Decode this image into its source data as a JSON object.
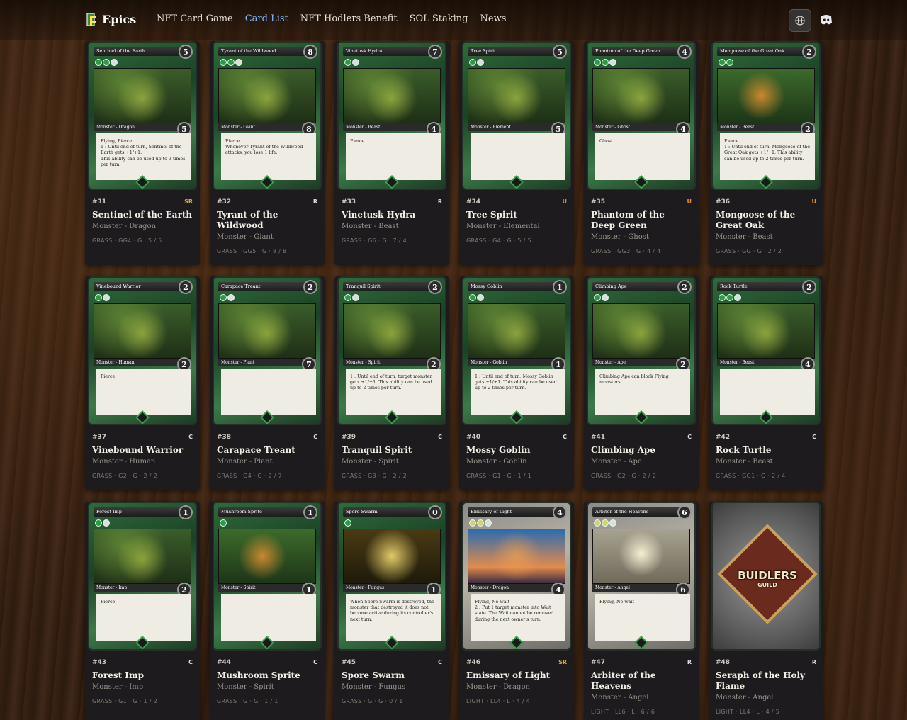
{
  "header": {
    "brand": "Epics",
    "nav": [
      {
        "label": "NFT Card Game",
        "active": false
      },
      {
        "label": "Card List",
        "active": true
      },
      {
        "label": "NFT Hodlers Benefit",
        "active": false
      },
      {
        "label": "SOL Staking",
        "active": false
      },
      {
        "label": "News",
        "active": false
      }
    ],
    "accent_color": "#7fb6ff"
  },
  "cards": [
    {
      "num": "#31",
      "rarity": "SR",
      "name": "Sentinel of the Earth",
      "type": "Monster - Dragon",
      "meta": "GRASS · GG4 · G · 5 / 5",
      "art": {
        "title": "Sentinel of the Earth",
        "cost": "5",
        "mana": [
          "g",
          "g",
          "4"
        ],
        "type": "Monster - Dragon",
        "stat": "5",
        "text": "Flying, Pierce\n1 : Until end of turn, Sentinel of the Earth gets +1/+1.\nThis ability can be used up to 3 times per turn."
      }
    },
    {
      "num": "#32",
      "rarity": "R",
      "name": "Tyrant of the Wildwood",
      "type": "Monster - Giant",
      "meta": "GRASS · GG5 · G · 8 / 8",
      "art": {
        "title": "Tyrant of the Wildwood",
        "cost": "8",
        "mana": [
          "g",
          "g",
          "5"
        ],
        "type": "Monster - Giant",
        "stat": "8",
        "text": "Pierce\nWhenever Tyrant of the Wildwood attacks, you lose 1 life."
      }
    },
    {
      "num": "#33",
      "rarity": "R",
      "name": "Vinetusk Hydra",
      "type": "Monster - Beast",
      "meta": "GRASS · G6 · G · 7 / 4",
      "art": {
        "title": "Vinetusk Hydra",
        "cost": "7",
        "mana": [
          "g",
          "6"
        ],
        "type": "Monster - Beast",
        "stat": "4",
        "text": "Pierce"
      }
    },
    {
      "num": "#34",
      "rarity": "U",
      "name": "Tree Spirit",
      "type": "Monster - Elemental",
      "meta": "GRASS · G4 · G · 5 / 5",
      "art": {
        "title": "Tree Spirit",
        "cost": "5",
        "mana": [
          "g",
          "4"
        ],
        "type": "Monster - Element",
        "stat": "5",
        "text": ""
      }
    },
    {
      "num": "#35",
      "rarity": "U",
      "name": "Phantom of the Deep Green",
      "type": "Monster - Ghost",
      "meta": "GRASS · GG3 · G · 4 / 4",
      "art": {
        "title": "Phantom of the Deep Green",
        "cost": "4",
        "mana": [
          "g",
          "g",
          "3"
        ],
        "type": "Monster - Ghost",
        "stat": "4",
        "text": "Ghost"
      }
    },
    {
      "num": "#36",
      "rarity": "U",
      "name": "Mongoose of the Great Oak",
      "type": "Monster - Beast",
      "meta": "GRASS · GG · G · 2 / 2",
      "art": {
        "title": "Mongoose of the Great Oak",
        "cost": "2",
        "mana": [
          "g",
          "g"
        ],
        "type": "Monster - Beast",
        "stat": "2",
        "text": "Pierce\n1 : Until end of turn, Mongoose of the Great Oak gets +1/+1. This ability can be used up to 2 times per turn."
      }
    },
    {
      "num": "#37",
      "rarity": "C",
      "name": "Vinebound Warrior",
      "type": "Monster - Human",
      "meta": "GRASS · G2 · G · 2 / 2",
      "art": {
        "title": "Vinebound Warrior",
        "cost": "2",
        "mana": [
          "g",
          "2"
        ],
        "type": "Monster - Human",
        "stat": "2",
        "text": "Pierce"
      }
    },
    {
      "num": "#38",
      "rarity": "C",
      "name": "Carapace Treant",
      "type": "Monster - Plant",
      "meta": "GRASS · G4 · G · 2 / 7",
      "art": {
        "title": "Carapace Treant",
        "cost": "2",
        "mana": [
          "g",
          "4"
        ],
        "type": "Monster - Plant",
        "stat": "7",
        "text": ""
      }
    },
    {
      "num": "#39",
      "rarity": "C",
      "name": "Tranquil Spirit",
      "type": "Monster - Spirit",
      "meta": "GRASS · G3 · G · 2 / 2",
      "art": {
        "title": "Tranquil Spirit",
        "cost": "2",
        "mana": [
          "g",
          "4"
        ],
        "type": "Monster - Spirit",
        "stat": "2",
        "text": "1 : Until end of turn, target monster gets +1/+1. This ability can be used up to 2 times per turn."
      }
    },
    {
      "num": "#40",
      "rarity": "C",
      "name": "Mossy Goblin",
      "type": "Monster - Goblin",
      "meta": "GRASS · G1 · G · 1 / 1",
      "art": {
        "title": "Mossy Goblin",
        "cost": "1",
        "mana": [
          "g",
          "1"
        ],
        "type": "Monster - Goblin",
        "stat": "1",
        "text": "1 : Until end of turn, Mossy Goblin gets +1/+1. This ability can be used up to 2 times per turn."
      }
    },
    {
      "num": "#41",
      "rarity": "C",
      "name": "Climbing Ape",
      "type": "Monster - Ape",
      "meta": "GRASS · G2 · G · 2 / 2",
      "art": {
        "title": "Climbing Ape",
        "cost": "2",
        "mana": [
          "g",
          "2"
        ],
        "type": "Monster - Ape",
        "stat": "2",
        "text": "Climbing Ape can block Flying monsters."
      }
    },
    {
      "num": "#42",
      "rarity": "C",
      "name": "Rock Turtle",
      "type": "Monster - Beast",
      "meta": "GRASS · GG1 · G · 2 / 4",
      "art": {
        "title": "Rock Turtle",
        "cost": "2",
        "mana": [
          "g",
          "g",
          "1"
        ],
        "type": "Monster - Beast",
        "stat": "4",
        "text": ""
      }
    },
    {
      "num": "#43",
      "rarity": "C",
      "name": "Forest Imp",
      "type": "Monster - Imp",
      "meta": "GRASS · G1 · G · 1 / 2",
      "art": {
        "title": "Forest Imp",
        "cost": "1",
        "mana": [
          "g",
          "1"
        ],
        "type": "Monster - Imp",
        "stat": "2",
        "text": "Pierce"
      }
    },
    {
      "num": "#44",
      "rarity": "C",
      "name": "Mushroom Sprite",
      "type": "Monster - Spirit",
      "meta": "GRASS · G · G · 1 / 1",
      "art": {
        "title": "Mushroom Sprite",
        "cost": "1",
        "mana": [
          "g"
        ],
        "type": "Monster - Spirit",
        "stat": "1",
        "text": ""
      }
    },
    {
      "num": "#45",
      "rarity": "C",
      "name": "Spore Swarm",
      "type": "Monster - Fungus",
      "meta": "GRASS · G · G · 0 / 1",
      "art": {
        "title": "Spore Swarm",
        "cost": "0",
        "mana": [
          "g"
        ],
        "type": "Monster - Fungus",
        "stat": "1",
        "text": "When Spore Swarm is destroyed, the monster that destroyed it does not become active during its controller's next turn."
      }
    },
    {
      "num": "#46",
      "rarity": "SR",
      "name": "Emissary of Light",
      "type": "Monster - Dragon",
      "meta": "LIGHT · LL4 · L · 4 / 4",
      "art": {
        "title": "Emissary of Light",
        "cost": "4",
        "mana": [
          "l",
          "l",
          "4"
        ],
        "type": "Monster - Dragon",
        "stat": "4",
        "text": "Flying, No wait\n2 : Put 1 target monster into Wait state. The Wait cannot be removed during the next owner's turn."
      }
    },
    {
      "num": "#47",
      "rarity": "R",
      "name": "Arbiter of the Heavens",
      "type": "Monster - Angel",
      "meta": "LIGHT · LL6 · L · 6 / 6",
      "art": {
        "title": "Arbiter of the Heavens",
        "cost": "6",
        "mana": [
          "l",
          "l",
          "6"
        ],
        "type": "Monster - Angel",
        "stat": "6",
        "text": "Flying, No wait"
      }
    },
    {
      "num": "#48",
      "rarity": "R",
      "name": "Seraph of the Holy Flame",
      "type": "Monster - Angel",
      "meta": "LIGHT · LL4 · L · 4 / 5",
      "art": {
        "back": true,
        "crest": "BUIDLERS",
        "crest_sub": "GUILD"
      }
    }
  ]
}
